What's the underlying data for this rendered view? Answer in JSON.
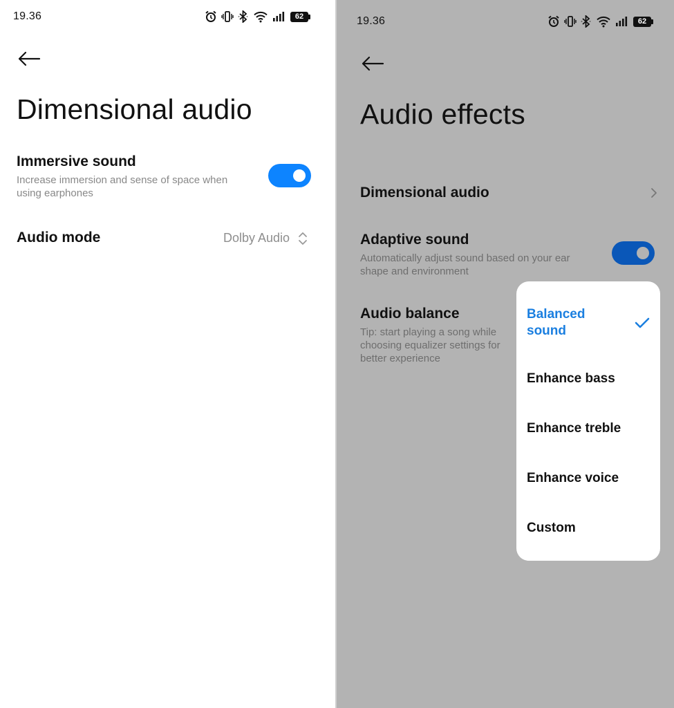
{
  "left_screen": {
    "status_bar": {
      "time": "19.36",
      "battery": "62"
    },
    "title": "Dimensional audio",
    "immersive_sound": {
      "title": "Immersive sound",
      "description": "Increase immersion and sense of space when using earphones",
      "enabled": true
    },
    "audio_mode": {
      "title": "Audio mode",
      "value": "Dolby Audio"
    }
  },
  "right_screen": {
    "status_bar": {
      "time": "19.36",
      "battery": "62"
    },
    "title": "Audio effects",
    "dimensional_audio": {
      "title": "Dimensional audio"
    },
    "adaptive_sound": {
      "title": "Adaptive sound",
      "description": "Automatically adjust sound based on your ear shape and environment",
      "enabled": true
    },
    "audio_balance": {
      "title": "Audio balance",
      "description": "Tip: start playing a song while choosing equalizer settings for better experience"
    },
    "audio_balance_menu": {
      "options": [
        {
          "label": "Balanced sound",
          "selected": true
        },
        {
          "label": "Enhance bass",
          "selected": false
        },
        {
          "label": "Enhance treble",
          "selected": false
        },
        {
          "label": "Enhance voice",
          "selected": false
        },
        {
          "label": "Custom",
          "selected": false
        }
      ]
    }
  },
  "icons": {
    "status": [
      "alarm-icon",
      "vibrate-icon",
      "bluetooth-icon",
      "wifi-icon",
      "signal-icon",
      "battery-icon"
    ],
    "back": "back-arrow-icon",
    "chevron": "chevron-right-icon",
    "selector": "up-down-chevron-icon",
    "check": "checkmark-icon"
  },
  "colors": {
    "accent_blue": "#0d84ff",
    "toggle_dimmed": "#0a57b8",
    "selected_text": "#1b7fe0",
    "overlay_gray": "#b3b3b3"
  }
}
